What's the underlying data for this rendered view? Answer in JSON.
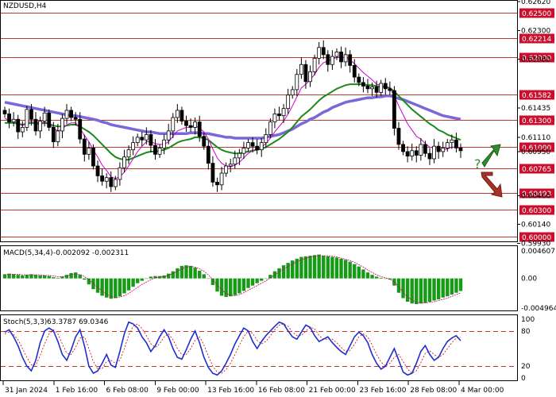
{
  "header": {
    "symbol_label": "NZDUSD,H4"
  },
  "colors": {
    "level_line": "#c0392b",
    "level_box": "#c8102e",
    "candle": "#000000",
    "ma_fast": "#cc00cc",
    "ma_mid": "#1a8a1a",
    "ma_slow": "#7b68d8",
    "macd_hist": "#159b15",
    "macd_signal": "#cc0066",
    "stoch_main": "#1f2fcf",
    "stoch_signal": "#cc0000",
    "arrow_up": "#2e8b2e",
    "arrow_down": "#a93226",
    "question_mark": "#2e8b2e"
  },
  "chart_data": [
    {
      "type": "candlestick",
      "title": "NZDUSD,H4",
      "ylim": [
        0.5995,
        0.6263
      ],
      "price_axis_labels": [
        "0.62620",
        "0.62300",
        "0.61980",
        "0.61435",
        "0.61110",
        "0.60950",
        "0.60460",
        "0.60140",
        "0.59930"
      ],
      "levels": [
        {
          "label": "0.62500",
          "value": 0.625
        },
        {
          "label": "0.62214",
          "value": 0.62214
        },
        {
          "label": "0.62000",
          "value": 0.62
        },
        {
          "label": "0.61582",
          "value": 0.61582
        },
        {
          "label": "0.61300",
          "value": 0.613
        },
        {
          "label": "0.61000",
          "value": 0.61
        },
        {
          "label": "0.60765",
          "value": 0.60765
        },
        {
          "label": "0.60493",
          "value": 0.60493
        },
        {
          "label": "0.60300",
          "value": 0.603
        },
        {
          "label": "0.60000",
          "value": 0.6
        }
      ],
      "closes": [
        0.6137,
        0.6128,
        0.6131,
        0.6117,
        0.6122,
        0.6142,
        0.6131,
        0.6118,
        0.6129,
        0.6138,
        0.6122,
        0.6106,
        0.6118,
        0.6132,
        0.6141,
        0.6133,
        0.6131,
        0.6109,
        0.6092,
        0.6099,
        0.6079,
        0.6068,
        0.6062,
        0.6066,
        0.6056,
        0.6064,
        0.6077,
        0.6089,
        0.6097,
        0.6105,
        0.6111,
        0.6108,
        0.6114,
        0.6102,
        0.6092,
        0.6099,
        0.6108,
        0.6118,
        0.6133,
        0.6141,
        0.6129,
        0.6124,
        0.6122,
        0.6128,
        0.6112,
        0.6101,
        0.6082,
        0.6061,
        0.6058,
        0.6071,
        0.6079,
        0.6081,
        0.6088,
        0.6093,
        0.6099,
        0.6105,
        0.6101,
        0.6097,
        0.6105,
        0.6114,
        0.6128,
        0.6137,
        0.6135,
        0.6143,
        0.6158,
        0.6164,
        0.6181,
        0.6192,
        0.6173,
        0.6184,
        0.6199,
        0.6211,
        0.6203,
        0.6192,
        0.6201,
        0.6206,
        0.6195,
        0.6203,
        0.6191,
        0.6178,
        0.6172,
        0.6168,
        0.6165,
        0.6167,
        0.6161,
        0.6171,
        0.6165,
        0.6163,
        0.6121,
        0.6103,
        0.6095,
        0.609,
        0.6096,
        0.6091,
        0.6103,
        0.6093,
        0.6087,
        0.6101,
        0.6095,
        0.6099,
        0.6105,
        0.6108,
        0.6099,
        0.6096
      ],
      "ma_fast": [
        0.6132,
        0.613,
        0.6129,
        0.6126,
        0.6124,
        0.6127,
        0.6129,
        0.6127,
        0.6127,
        0.6128,
        0.6126,
        0.6121,
        0.6118,
        0.612,
        0.6125,
        0.6127,
        0.6127,
        0.6121,
        0.6113,
        0.6106,
        0.6097,
        0.6089,
        0.608,
        0.6074,
        0.6067,
        0.6065,
        0.6067,
        0.6072,
        0.6079,
        0.6087,
        0.6095,
        0.6101,
        0.6106,
        0.6106,
        0.6104,
        0.6103,
        0.6103,
        0.6106,
        0.6112,
        0.6118,
        0.612,
        0.6122,
        0.6122,
        0.6124,
        0.6121,
        0.6117,
        0.6109,
        0.6098,
        0.6088,
        0.6082,
        0.6079,
        0.6078,
        0.608,
        0.6083,
        0.6088,
        0.6093,
        0.6096,
        0.6098,
        0.61,
        0.6104,
        0.611,
        0.6117,
        0.6123,
        0.6129,
        0.6137,
        0.6146,
        0.6156,
        0.6166,
        0.617,
        0.6175,
        0.6181,
        0.6189,
        0.6194,
        0.6196,
        0.6198,
        0.62,
        0.62,
        0.62,
        0.6197,
        0.6193,
        0.6188,
        0.6183,
        0.6179,
        0.6175,
        0.617,
        0.6169,
        0.6167,
        0.6166,
        0.6157,
        0.6146,
        0.6136,
        0.6126,
        0.6119,
        0.6112,
        0.6109,
        0.6104,
        0.61,
        0.6099,
        0.6097,
        0.6097,
        0.6098,
        0.61,
        0.61,
        0.6099
      ],
      "ma_mid": [
        0.6127,
        0.6127,
        0.6127,
        0.6126,
        0.6125,
        0.6126,
        0.6127,
        0.6126,
        0.6126,
        0.6127,
        0.6126,
        0.6124,
        0.6123,
        0.6123,
        0.6124,
        0.6125,
        0.6125,
        0.6123,
        0.612,
        0.6117,
        0.6113,
        0.6108,
        0.6103,
        0.6098,
        0.6093,
        0.6089,
        0.6087,
        0.6086,
        0.6086,
        0.6088,
        0.609,
        0.6092,
        0.6094,
        0.6095,
        0.6095,
        0.6096,
        0.6097,
        0.6099,
        0.6102,
        0.6105,
        0.6107,
        0.6108,
        0.6109,
        0.6111,
        0.6111,
        0.611,
        0.6108,
        0.6104,
        0.61,
        0.6097,
        0.6095,
        0.6094,
        0.6093,
        0.6093,
        0.6094,
        0.6095,
        0.6096,
        0.6097,
        0.6098,
        0.61,
        0.6103,
        0.6106,
        0.6109,
        0.6113,
        0.6117,
        0.6122,
        0.6128,
        0.6134,
        0.6138,
        0.6142,
        0.6147,
        0.6152,
        0.6156,
        0.6159,
        0.6162,
        0.6165,
        0.6167,
        0.6169,
        0.617,
        0.617,
        0.617,
        0.617,
        0.6169,
        0.6169,
        0.6168,
        0.6167,
        0.6167,
        0.6166,
        0.6162,
        0.6157,
        0.6152,
        0.6147,
        0.6142,
        0.6138,
        0.6134,
        0.613,
        0.6126,
        0.6123,
        0.6119,
        0.6117,
        0.6114,
        0.6112,
        0.611,
        0.6108
      ],
      "ma_slow": [
        0.615,
        0.6149,
        0.6148,
        0.6147,
        0.6146,
        0.6145,
        0.6144,
        0.6143,
        0.6142,
        0.6141,
        0.614,
        0.6139,
        0.6138,
        0.6137,
        0.6136,
        0.6135,
        0.6135,
        0.6134,
        0.6133,
        0.6132,
        0.6131,
        0.613,
        0.6128,
        0.6127,
        0.6125,
        0.6124,
        0.6123,
        0.6122,
        0.6121,
        0.612,
        0.6119,
        0.6118,
        0.6117,
        0.6117,
        0.6116,
        0.6115,
        0.6115,
        0.6115,
        0.6115,
        0.6115,
        0.6115,
        0.6115,
        0.6116,
        0.6116,
        0.6116,
        0.6115,
        0.6115,
        0.6114,
        0.6113,
        0.6112,
        0.6111,
        0.6111,
        0.611,
        0.611,
        0.611,
        0.611,
        0.611,
        0.611,
        0.611,
        0.6111,
        0.6112,
        0.6113,
        0.6114,
        0.6116,
        0.6118,
        0.612,
        0.6123,
        0.6126,
        0.6128,
        0.6131,
        0.6133,
        0.6136,
        0.6139,
        0.6141,
        0.6144,
        0.6146,
        0.6148,
        0.615,
        0.6151,
        0.6152,
        0.6153,
        0.6154,
        0.6155,
        0.6155,
        0.6156,
        0.6156,
        0.6157,
        0.6157,
        0.6156,
        0.6154,
        0.6153,
        0.6151,
        0.6149,
        0.6147,
        0.6145,
        0.6143,
        0.6141,
        0.6139,
        0.6137,
        0.6135,
        0.6134,
        0.6133,
        0.6132,
        0.6131
      ]
    },
    {
      "type": "bar",
      "title": "MACD(5,34,4)",
      "readout": "-0.002092 -0.002311",
      "ylim": [
        -0.004964,
        0.004607
      ],
      "axis_labels": [
        "0.004607",
        "0.00",
        "-0.004964"
      ],
      "values": [
        0.0007,
        0.0008,
        0.0007,
        0.0006,
        0.0005,
        0.0006,
        0.0007,
        0.0006,
        0.0005,
        0.0005,
        0.0004,
        0.0002,
        0.0001,
        0.0003,
        0.0006,
        0.0009,
        0.001,
        0.0006,
        -0.0002,
        -0.001,
        -0.0018,
        -0.0024,
        -0.0029,
        -0.0032,
        -0.0034,
        -0.0033,
        -0.003,
        -0.0025,
        -0.002,
        -0.0014,
        -0.0008,
        -0.0004,
        0.0,
        0.0003,
        0.0004,
        0.0004,
        0.0005,
        0.0008,
        0.0012,
        0.0017,
        0.0021,
        0.0022,
        0.0021,
        0.0018,
        0.0013,
        0.0007,
        0.0,
        -0.0011,
        -0.0022,
        -0.0029,
        -0.0031,
        -0.003,
        -0.0028,
        -0.0025,
        -0.0021,
        -0.0016,
        -0.0012,
        -0.0008,
        -0.0004,
        0.0,
        0.0006,
        0.0012,
        0.0017,
        0.0022,
        0.0026,
        0.003,
        0.0033,
        0.0036,
        0.0037,
        0.0038,
        0.0039,
        0.004,
        0.0038,
        0.0037,
        0.0036,
        0.0035,
        0.0033,
        0.0031,
        0.0028,
        0.0024,
        0.002,
        0.0015,
        0.001,
        0.0006,
        0.0003,
        0.0001,
        0.0,
        -0.0002,
        -0.0012,
        -0.0024,
        -0.0033,
        -0.0039,
        -0.0042,
        -0.0043,
        -0.0042,
        -0.0041,
        -0.0039,
        -0.0037,
        -0.0035,
        -0.0032,
        -0.003,
        -0.0027,
        -0.0024,
        -0.0021
      ],
      "signal": [
        0.0006,
        0.0007,
        0.0007,
        0.0007,
        0.0006,
        0.0006,
        0.0006,
        0.0006,
        0.0006,
        0.0005,
        0.0005,
        0.0004,
        0.0003,
        0.0003,
        0.0004,
        0.0006,
        0.0007,
        0.0007,
        0.0003,
        -0.0002,
        -0.0009,
        -0.0015,
        -0.0021,
        -0.0026,
        -0.003,
        -0.0032,
        -0.0031,
        -0.0029,
        -0.0025,
        -0.002,
        -0.0015,
        -0.001,
        -0.0006,
        -0.0002,
        0.0001,
        0.0002,
        0.0003,
        0.0005,
        0.0008,
        0.0012,
        0.0016,
        0.0019,
        0.002,
        0.0019,
        0.0016,
        0.0012,
        0.0006,
        -0.0002,
        -0.0011,
        -0.0019,
        -0.0025,
        -0.0028,
        -0.0029,
        -0.0027,
        -0.0024,
        -0.002,
        -0.0016,
        -0.0012,
        -0.0008,
        -0.0004,
        0.0001,
        0.0006,
        0.0011,
        0.0016,
        0.002,
        0.0024,
        0.0028,
        0.0031,
        0.0034,
        0.0036,
        0.0037,
        0.0038,
        0.0038,
        0.0038,
        0.0037,
        0.0036,
        0.0034,
        0.0032,
        0.003,
        0.0027,
        0.0023,
        0.0019,
        0.0014,
        0.001,
        0.0006,
        0.0003,
        0.0001,
        -0.0001,
        -0.0006,
        -0.0014,
        -0.0023,
        -0.0031,
        -0.0036,
        -0.004,
        -0.0041,
        -0.0041,
        -0.004,
        -0.0039,
        -0.0037,
        -0.0035,
        -0.0033,
        -0.003,
        -0.0027,
        -0.0024
      ]
    },
    {
      "type": "line",
      "title": "Stoch(5,3,3)",
      "readout": "63.3787 69.0346",
      "ylim": [
        0,
        100
      ],
      "axis_labels": [
        "100",
        "80",
        "20",
        "0"
      ],
      "levels": [
        80,
        20
      ],
      "main": [
        78,
        82,
        70,
        55,
        35,
        20,
        12,
        30,
        60,
        80,
        85,
        80,
        62,
        40,
        30,
        48,
        70,
        82,
        55,
        20,
        8,
        12,
        25,
        40,
        22,
        18,
        45,
        75,
        95,
        92,
        85,
        70,
        60,
        45,
        55,
        70,
        82,
        70,
        50,
        35,
        32,
        48,
        66,
        80,
        60,
        35,
        18,
        8,
        5,
        12,
        25,
        40,
        58,
        72,
        85,
        80,
        62,
        50,
        62,
        72,
        80,
        88,
        95,
        92,
        80,
        70,
        66,
        78,
        90,
        86,
        72,
        62,
        66,
        70,
        60,
        52,
        45,
        40,
        55,
        70,
        78,
        72,
        60,
        40,
        25,
        15,
        20,
        35,
        50,
        30,
        10,
        5,
        8,
        25,
        45,
        55,
        40,
        30,
        35,
        50,
        62,
        68,
        72,
        63.3787
      ],
      "signal": [
        75,
        78,
        74,
        65,
        50,
        35,
        22,
        22,
        38,
        58,
        75,
        82,
        75,
        58,
        42,
        40,
        52,
        68,
        70,
        50,
        28,
        15,
        16,
        28,
        30,
        25,
        30,
        50,
        72,
        88,
        92,
        84,
        72,
        58,
        52,
        58,
        70,
        75,
        65,
        50,
        40,
        40,
        50,
        64,
        70,
        56,
        37,
        20,
        10,
        8,
        14,
        25,
        40,
        56,
        70,
        80,
        76,
        64,
        58,
        62,
        72,
        82,
        90,
        92,
        88,
        78,
        72,
        72,
        80,
        86,
        84,
        72,
        66,
        66,
        66,
        60,
        52,
        45,
        47,
        57,
        70,
        75,
        70,
        56,
        40,
        27,
        20,
        25,
        35,
        40,
        28,
        15,
        8,
        12,
        26,
        42,
        46,
        40,
        35,
        40,
        50,
        60,
        68,
        69.0346
      ]
    }
  ],
  "time_axis": {
    "labels": [
      "31 Jan 2024",
      "1 Feb 16:00",
      "6 Feb 08:00",
      "9 Feb 00:00",
      "13 Feb 16:00",
      "16 Feb 08:00",
      "21 Feb 00:00",
      "23 Feb 16:00",
      "28 Feb 08:00",
      "4 Mar 00:00"
    ]
  },
  "annotations": {
    "question_mark": "?"
  }
}
